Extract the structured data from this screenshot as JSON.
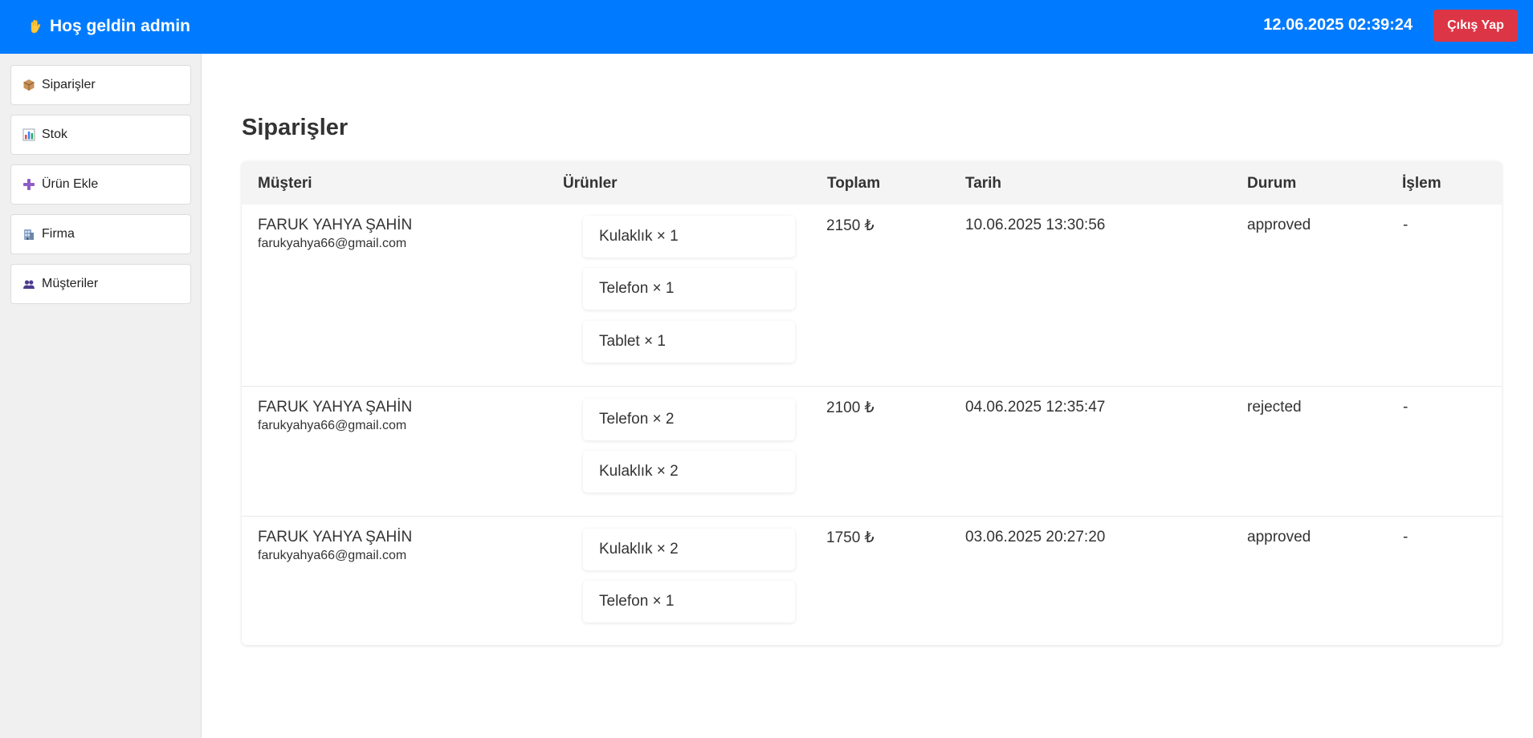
{
  "header": {
    "greeting_icon": "waving-hand-icon",
    "greeting": "Hoş geldin admin",
    "datetime": "12.06.2025 02:39:24",
    "logout_label": "Çıkış Yap",
    "bg_color": "#007bff",
    "logout_color": "#dc3545"
  },
  "sidebar": {
    "items": [
      {
        "icon": "package-icon",
        "label": "Siparişler"
      },
      {
        "icon": "bar-chart-icon",
        "label": "Stok"
      },
      {
        "icon": "plus-icon",
        "label": "Ürün Ekle"
      },
      {
        "icon": "building-icon",
        "label": "Firma"
      },
      {
        "icon": "users-icon",
        "label": "Müşteriler"
      }
    ]
  },
  "main": {
    "title": "Siparişler",
    "columns": [
      "Müşteri",
      "Ürünler",
      "Toplam",
      "Tarih",
      "Durum",
      "İşlem"
    ],
    "orders": [
      {
        "customer_name": "FARUK YAHYA ŞAHİN",
        "customer_email": "farukyahya66@gmail.com",
        "products": [
          "Kulaklık × 1",
          "Telefon × 1",
          "Tablet × 1"
        ],
        "total": "2150 ₺",
        "date": "10.06.2025 13:30:56",
        "status": "approved",
        "action": "-"
      },
      {
        "customer_name": "FARUK YAHYA ŞAHİN",
        "customer_email": "farukyahya66@gmail.com",
        "products": [
          "Telefon × 2",
          "Kulaklık × 2"
        ],
        "total": "2100 ₺",
        "date": "04.06.2025 12:35:47",
        "status": "rejected",
        "action": "-"
      },
      {
        "customer_name": "FARUK YAHYA ŞAHİN",
        "customer_email": "farukyahya66@gmail.com",
        "products": [
          "Kulaklık × 2",
          "Telefon × 1"
        ],
        "total": "1750 ₺",
        "date": "03.06.2025 20:27:20",
        "status": "approved",
        "action": "-"
      }
    ]
  }
}
